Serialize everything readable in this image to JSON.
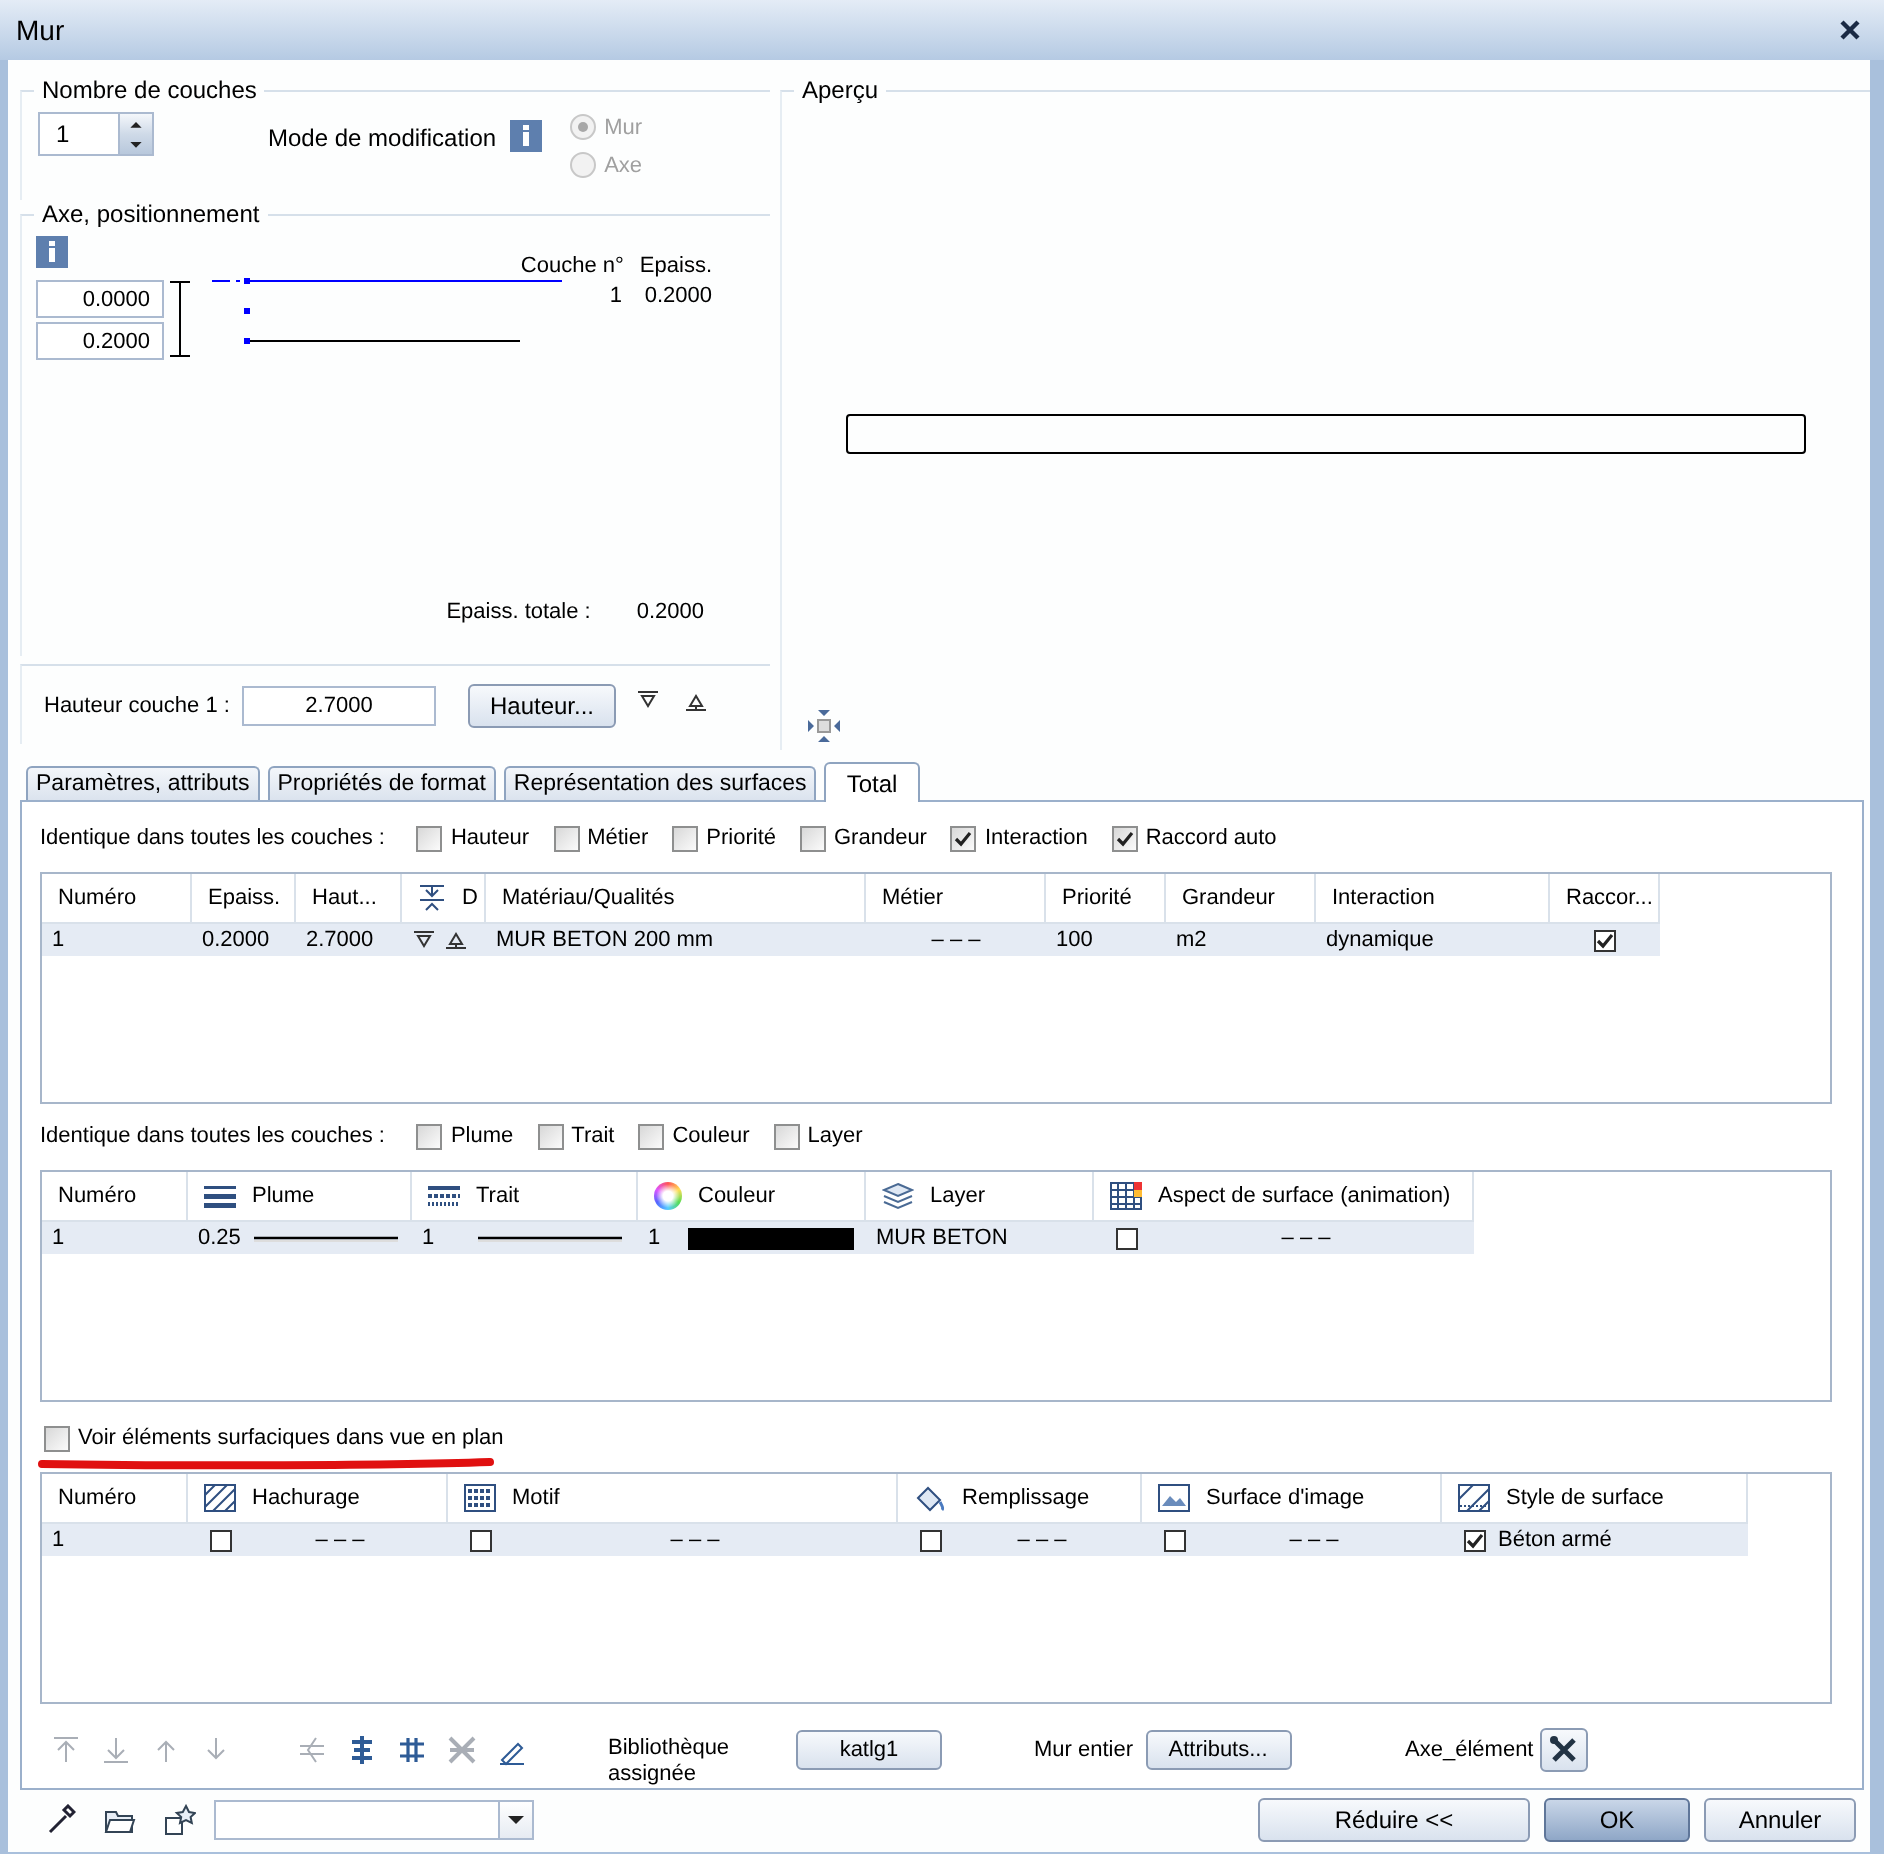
{
  "window": {
    "title": "Mur"
  },
  "layer_count": {
    "label": "Nombre de couches",
    "value": "1"
  },
  "edit_mode": {
    "label": "Mode de modification",
    "options": [
      {
        "label": "Mur",
        "selected": true,
        "disabled": true
      },
      {
        "label": "Axe",
        "selected": false,
        "disabled": true
      }
    ]
  },
  "axis": {
    "label": "Axe, positionnement",
    "offsets": [
      "0.0000",
      "0.2000"
    ],
    "columns": [
      "Couche n°",
      "Epaiss."
    ],
    "layers": [
      {
        "number": "1",
        "thickness": "0.2000"
      }
    ],
    "total_label": "Epaiss. totale :",
    "total": "0.2000"
  },
  "layer_height": {
    "label": "Hauteur couche 1 :",
    "value": "2.7000",
    "button": "Hauteur..."
  },
  "preview": {
    "label": "Aperçu"
  },
  "tabs": [
    {
      "label": "Paramètres, attributs",
      "selected": false
    },
    {
      "label": "Propriétés de format",
      "selected": false
    },
    {
      "label": "Représentation des surfaces",
      "selected": false
    },
    {
      "label": "Total",
      "selected": true
    }
  ],
  "same_in_all_layers_1": {
    "label": "Identique dans toutes les couches :",
    "options": [
      {
        "label": "Hauteur",
        "checked": false
      },
      {
        "label": "Métier",
        "checked": false
      },
      {
        "label": "Priorité",
        "checked": false
      },
      {
        "label": "Grandeur",
        "checked": false
      },
      {
        "label": "Interaction",
        "checked": true
      },
      {
        "label": "Raccord auto",
        "checked": true
      }
    ]
  },
  "layers_table": {
    "columns": [
      "Numéro",
      "Epaiss.",
      "Haut...",
      "D",
      "Matériau/Qualités",
      "Métier",
      "Priorité",
      "Grandeur",
      "Interaction",
      "Raccor..."
    ],
    "rows": [
      {
        "selected": true,
        "cells": [
          {
            "kind": "text",
            "text": "1"
          },
          {
            "kind": "text",
            "text": "0.2000"
          },
          {
            "kind": "text",
            "text": "2.7000"
          },
          {
            "kind": "levels"
          },
          {
            "kind": "text",
            "text": "MUR BETON 200 mm"
          },
          {
            "kind": "dash",
            "text": "– – –"
          },
          {
            "kind": "text",
            "text": "100"
          },
          {
            "kind": "text",
            "text": "m2"
          },
          {
            "kind": "text",
            "text": "dynamique"
          },
          {
            "kind": "check",
            "checked": true
          }
        ]
      }
    ]
  },
  "same_in_all_layers_2": {
    "label": "Identique dans toutes les couches :",
    "options": [
      {
        "label": "Plume",
        "checked": false
      },
      {
        "label": "Trait",
        "checked": false
      },
      {
        "label": "Couleur",
        "checked": false
      },
      {
        "label": "Layer",
        "checked": false
      }
    ]
  },
  "format_table": {
    "columns": [
      "Numéro",
      "Plume",
      "Trait",
      "Couleur",
      "Layer",
      "Aspect de surface (animation)"
    ],
    "rows": [
      {
        "selected": true,
        "cells": [
          {
            "kind": "text",
            "text": "1"
          },
          {
            "kind": "line",
            "text": "0.25"
          },
          {
            "kind": "line",
            "text": "1"
          },
          {
            "kind": "swatch",
            "text": "1",
            "color": "#000000"
          },
          {
            "kind": "text",
            "text": "MUR BETON"
          },
          {
            "kind": "check_text",
            "checked": false,
            "text": "– – –"
          }
        ]
      }
    ]
  },
  "show_surfaces": {
    "label": "Voir éléments surfaciques dans vue en plan",
    "checked": false,
    "highlighted": true
  },
  "surfaces_table": {
    "columns": [
      "Numéro",
      "Hachurage",
      "Motif",
      "Remplissage",
      "Surface d'image",
      "Style de surface"
    ],
    "rows": [
      {
        "selected": true,
        "cells": [
          {
            "kind": "text",
            "text": "1"
          },
          {
            "kind": "check_text",
            "checked": false,
            "text": "– – –"
          },
          {
            "kind": "check_text",
            "checked": false,
            "text": "– – –"
          },
          {
            "kind": "check_text",
            "checked": false,
            "text": "– – –"
          },
          {
            "kind": "check_text",
            "checked": false,
            "text": "– – –"
          },
          {
            "kind": "check_label",
            "checked": true,
            "text": "Béton armé"
          }
        ]
      }
    ]
  },
  "toolbar": {
    "tools": [
      {
        "disabled": true
      },
      {
        "disabled": true
      },
      {
        "disabled": true
      },
      {
        "disabled": true
      },
      {
        "disabled": true
      },
      {
        "disabled": false
      },
      {
        "disabled": false
      },
      {
        "disabled": true
      },
      {
        "disabled": false
      }
    ],
    "library_label": "Bibliothèque assignée",
    "library_button": "katlg1",
    "wall_label": "Mur entier",
    "wall_button": "Attributs...",
    "axis_label": "Axe_élément"
  },
  "footer": {
    "buttons": [
      {
        "label": "Réduire <<",
        "default": false
      },
      {
        "label": "OK",
        "default": true
      },
      {
        "label": "Annuler",
        "default": false
      }
    ]
  }
}
